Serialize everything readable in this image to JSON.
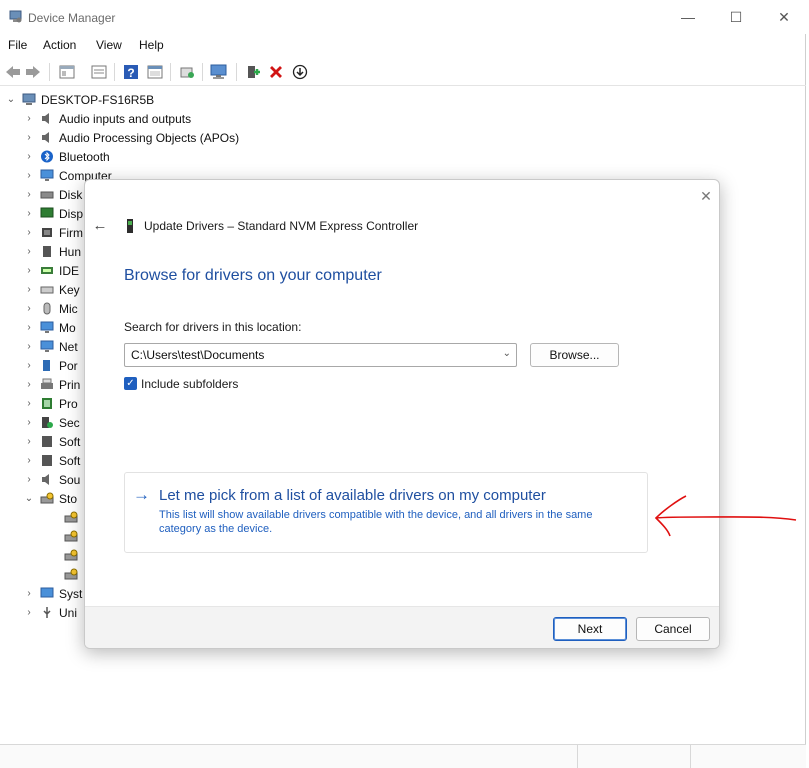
{
  "window": {
    "title": "Device Manager",
    "minimize_glyph": "—",
    "maximize_glyph": "☐",
    "close_glyph": "✕"
  },
  "menu": [
    "File",
    "Action",
    "View",
    "Help"
  ],
  "toolbar": {
    "icons": [
      "back-icon",
      "forward-icon",
      "show-hide-tree-icon",
      "properties-icon",
      "help-icon",
      "view-icon",
      "update-driver-icon",
      "scan-hardware-icon",
      "enable-device-icon",
      "uninstall-icon",
      "download-icon"
    ]
  },
  "tree": {
    "root": "DESKTOP-FS16R5B",
    "items": [
      {
        "label": "Audio inputs and outputs",
        "icon": "speaker-icon"
      },
      {
        "label": "Audio Processing Objects (APOs)",
        "icon": "speaker-icon"
      },
      {
        "label": "Bluetooth",
        "icon": "bluetooth-icon"
      },
      {
        "label": "Computer",
        "icon": "monitor-icon"
      },
      {
        "label": "Disk",
        "icon": "disk-icon"
      },
      {
        "label": "Disp",
        "icon": "display-icon"
      },
      {
        "label": "Firm",
        "icon": "firmware-icon"
      },
      {
        "label": "Hun",
        "icon": "hid-icon"
      },
      {
        "label": "IDE",
        "icon": "ide-icon"
      },
      {
        "label": "Key",
        "icon": "keyboard-icon"
      },
      {
        "label": "Mic",
        "icon": "mouse-icon"
      },
      {
        "label": "Mo",
        "icon": "monitor-icon"
      },
      {
        "label": "Net",
        "icon": "network-icon"
      },
      {
        "label": "Por",
        "icon": "port-icon"
      },
      {
        "label": "Prin",
        "icon": "printer-icon"
      },
      {
        "label": "Pro",
        "icon": "processor-icon"
      },
      {
        "label": "Sec",
        "icon": "security-icon"
      },
      {
        "label": "Soft",
        "icon": "software-icon"
      },
      {
        "label": "Soft",
        "icon": "software-icon"
      },
      {
        "label": "Sou",
        "icon": "speaker-icon"
      },
      {
        "label": "Sto",
        "icon": "storage-icon",
        "expanded": true
      },
      {
        "label": "",
        "icon": "storage-controller-icon",
        "child": true
      },
      {
        "label": "",
        "icon": "storage-controller-icon",
        "child": true
      },
      {
        "label": "",
        "icon": "storage-controller-icon",
        "child": true
      },
      {
        "label": "",
        "icon": "storage-controller-icon",
        "child": true
      },
      {
        "label": "Syst",
        "icon": "system-icon"
      },
      {
        "label": "Uni",
        "icon": "usb-icon"
      }
    ]
  },
  "dialog": {
    "title": "Update Drivers – Standard NVM Express Controller",
    "heading": "Browse for drivers on your computer",
    "search_label": "Search for drivers in this location:",
    "path_value": "C:\\Users\\test\\Documents",
    "browse_label": "Browse...",
    "include_subfolders_label": "Include subfolders",
    "include_subfolders_checked": true,
    "pick_title": "Let me pick from a list of available drivers on my computer",
    "pick_description": "This list will show available drivers compatible with the device, and all drivers in the same category as the device.",
    "next_label": "Next",
    "cancel_label": "Cancel"
  },
  "colors": {
    "accent": "#1f5fbf",
    "heading": "#1f4fa0",
    "annotation": "#e01010"
  }
}
